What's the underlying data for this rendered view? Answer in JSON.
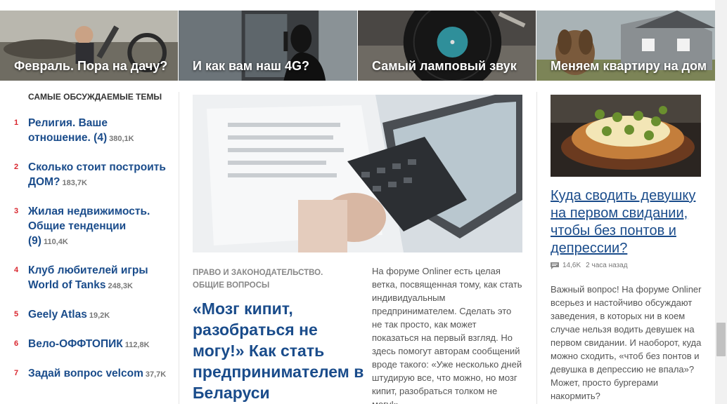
{
  "banner": {
    "tiles": [
      {
        "title": "Февраль. Пора на дачу?"
      },
      {
        "title": "И как вам наш 4G?"
      },
      {
        "title": "Самый ламповый звук"
      },
      {
        "title": "Меняем квартиру на дом"
      }
    ]
  },
  "sidebar": {
    "heading": "САМЫЕ ОБСУЖДАЕМЫЕ ТЕМЫ",
    "topics": [
      {
        "num": "1",
        "title": "Религия. Ваше отношение. (4)",
        "count": "380,1K"
      },
      {
        "num": "2",
        "title": "Сколько стоит построить ДОМ?",
        "count": "183,7K"
      },
      {
        "num": "3",
        "title": "Жилая недвижимость. Общие тенденции (9)",
        "count": "110,4K"
      },
      {
        "num": "4",
        "title": "Клуб любителей игры World of Tanks",
        "count": "248,3K"
      },
      {
        "num": "5",
        "title": "Geely Atlas",
        "count": "19,2K"
      },
      {
        "num": "6",
        "title": "Вело-ОФФТОПИК",
        "count": "112,8K"
      },
      {
        "num": "7",
        "title": "Задай вопрос velcom",
        "count": "37,7K"
      }
    ]
  },
  "main_article": {
    "category": "ПРАВО И ЗАКОНОДАТЕЛЬСТВО. ОБЩИЕ ВОПРОСЫ",
    "headline": "«Мозг кипит, разобраться не могу!» Как стать предпринимателем в Беларуси",
    "lead": "На форуме Onliner есть целая ветка, посвященная тому, как стать индивидуальным предпринимателем. Сделать это не так просто, как может показаться на первый взгляд. Но здесь помогут авторам сообщений вроде такого: «Уже несколько дней штудирую все, что можно, но мозг кипит, разобраться толком не могу!»"
  },
  "side_article": {
    "headline": "Куда сводить девушку на первом свидании, чтобы без понтов и депрессии?",
    "comments": "14,6K",
    "time": "2 часа назад",
    "lead": "Важный вопрос! На форуме Onliner всерьез и настойчиво обсуждают заведения, в которых ни в коем случае нельзя водить девушек на первом свидании. И наоборот, куда можно сходить, «чтоб без понтов и девушка в депрессию не впала»? Может, просто бургерами накормить?"
  },
  "colors": {
    "link": "#1a4c8b",
    "accent_red": "#d9272f",
    "muted": "#777777"
  }
}
